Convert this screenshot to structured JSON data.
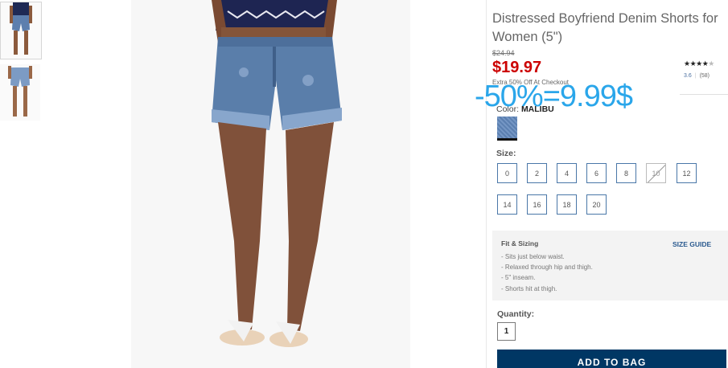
{
  "thumbnails": [
    {
      "label": "front view"
    },
    {
      "label": "back view"
    }
  ],
  "product": {
    "title": "Distressed Boyfriend Denim Shorts for Women (5\")",
    "old_price": "$24.94",
    "price": "$19.97",
    "promo": "Extra 50% Off At Checkout",
    "rating_value": "3.6",
    "rating_count": "(58)",
    "stars_filled": "★★★★",
    "stars_empty": "★"
  },
  "overlay_text": "-50%=9.99$",
  "color": {
    "label": "Color:",
    "value": "MALIBU"
  },
  "size": {
    "label": "Size:",
    "options": [
      "0",
      "2",
      "4",
      "6",
      "8",
      "10",
      "12",
      "14",
      "16",
      "18",
      "20"
    ],
    "unavailable": [
      "10"
    ]
  },
  "fit": {
    "title": "Fit & Sizing",
    "guide_label": "SIZE GUIDE",
    "items": [
      "- Sits just below waist.",
      "- Relaxed through hip and thigh.",
      "- 5\" inseam.",
      "- Shorts hit at thigh."
    ]
  },
  "quantity": {
    "label": "Quantity:",
    "value": "1"
  },
  "add_to_bag": "ADD TO BAG",
  "colors": {
    "price_red": "#cc0000",
    "overlay_blue": "#2aa6ea",
    "bag_button": "#003764",
    "size_border": "#4a77a8"
  }
}
